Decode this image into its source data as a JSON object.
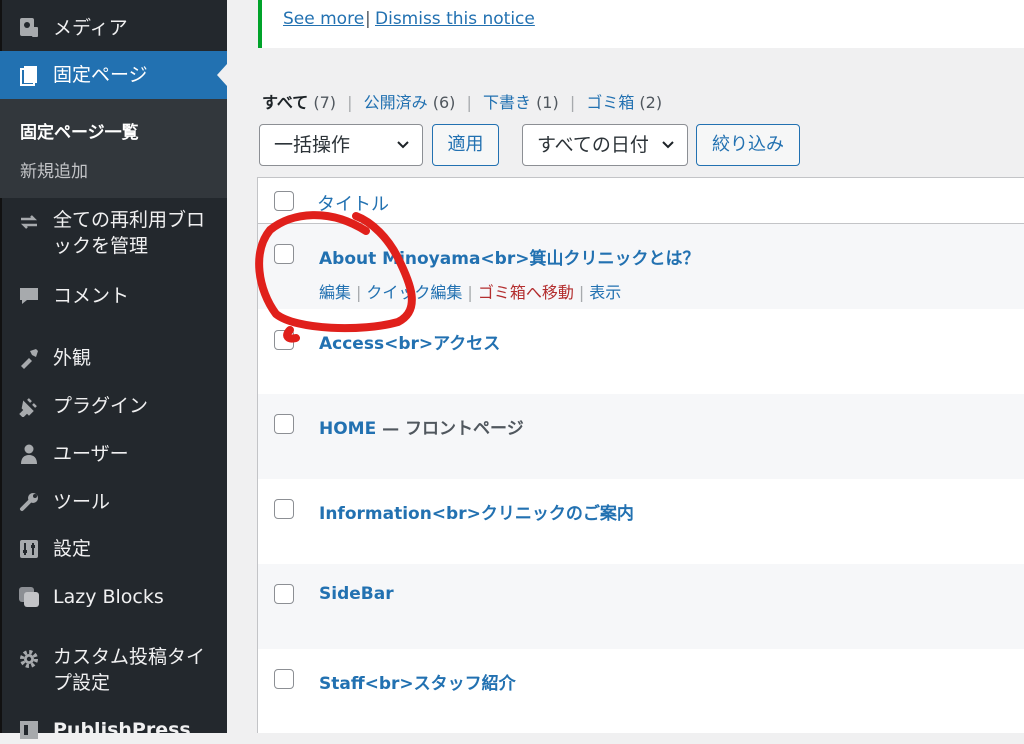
{
  "sidebar": {
    "media": "メディア",
    "pages": "固定ページ",
    "sub_all": "固定ページ一覧",
    "sub_add": "新規追加",
    "reusable_line1": "全ての再利用ブロ",
    "reusable_line2": "ックを管理",
    "comments": "コメント",
    "appearance": "外観",
    "plugins": "プラグイン",
    "users": "ユーザー",
    "tools": "ツール",
    "settings": "設定",
    "lazy_blocks": "Lazy Blocks",
    "cpt_line1": "カスタム投稿タイ",
    "cpt_line2": "プ設定",
    "publishpress": "PublishPress"
  },
  "notice": {
    "see_more": "See more",
    "separator": "|",
    "dismiss": "Dismiss this notice"
  },
  "views": {
    "all": "すべて",
    "all_count": "(7)",
    "published": "公開済み",
    "published_count": "(6)",
    "draft": "下書き",
    "draft_count": "(1)",
    "trash": "ゴミ箱",
    "trash_count": "(2)",
    "separator": "|"
  },
  "toolbar": {
    "bulk_action": "一括操作",
    "apply": "適用",
    "date_filter": "すべての日付",
    "filter": "絞り込み"
  },
  "table": {
    "column_title": "タイトル",
    "rows": [
      {
        "title": "About Minoyama<br>箕山クリニックとは？"
      },
      {
        "title": "Access<br>アクセス"
      },
      {
        "title": "HOME",
        "state": " — フロントページ"
      },
      {
        "title": "Information<br>クリニックのご案内"
      },
      {
        "title": "SideBar"
      },
      {
        "title": "Staff<br>スタッフ紹介"
      }
    ],
    "row_actions": {
      "edit": "編集",
      "quick_edit": "クイック編集",
      "trash": "ゴミ箱へ移動",
      "view": "表示",
      "separator": "|"
    }
  },
  "colors": {
    "accent": "#2271b1",
    "sidebar": "#23282d",
    "current": "#2271b1",
    "trash": "#b32d2e",
    "annotation": "#e0201b"
  },
  "icons": [
    "media-icon",
    "pages-icon",
    "reusable-blocks-icon",
    "comments-icon",
    "appearance-icon",
    "plugins-icon",
    "users-icon",
    "tools-icon",
    "settings-icon",
    "lazy-blocks-icon",
    "gear-icon",
    "publishpress-icon",
    "chevron-down-icon"
  ]
}
